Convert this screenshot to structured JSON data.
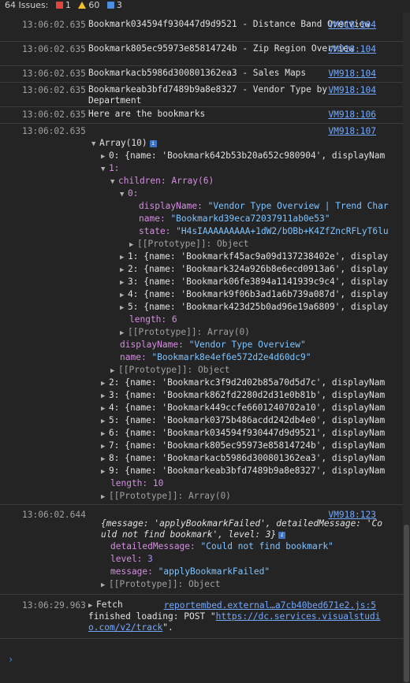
{
  "issues": {
    "label": "64 Issues:",
    "errors": "1",
    "warnings": "60",
    "infos": "3"
  },
  "messages": [
    {
      "ts": "13:06:02.635",
      "text": "Bookmark034594f930447d9d9521 - Distance Band Overview",
      "src": "VM918:104"
    },
    {
      "ts": "13:06:02.635",
      "text": "Bookmark805ec95973e85814724b - Zip Region Overview",
      "src": "VM918:104"
    },
    {
      "ts": "13:06:02.635",
      "text": "Bookmarkacb5986d300801362ea3 - Sales Maps",
      "src": "VM918:104"
    },
    {
      "ts": "13:06:02.635",
      "text": "Bookmarkeab3bfd7489b9a8e8327 - Vendor Type by Department",
      "src": "VM918:104"
    },
    {
      "ts": "13:06:02.635",
      "text": "Here are the bookmarks",
      "src": "VM918:106"
    }
  ],
  "array_msg": {
    "ts": "13:06:02.635",
    "src": "VM918:107",
    "head": "Array(10)",
    "item0": "0: {name: 'Bookmark642b53b20a652c980904', displayNam",
    "item1": "1:",
    "children": "children: Array(6)",
    "child0": "0:",
    "dn_key": "displayName:",
    "dn_val": "\"Vendor Type Overview | Trend Char",
    "name_key": "name:",
    "name_val": "\"Bookmarkd39eca72037911ab0e53\"",
    "state_key": "state:",
    "state_val": "\"H4sIAAAAAAAAA+1dW2/bOBb+K4ZfZncRFLyT6lu",
    "proto_obj": "[[Prototype]]: Object",
    "c1": "1: {name: 'Bookmarkf45ac9a09d137238402e', display",
    "c2": "2: {name: 'Bookmark324a926b8e6ecd0913a6', display",
    "c3": "3: {name: 'Bookmark06fe3894a1141939c9c4', display",
    "c4": "4: {name: 'Bookmark9f06b3ad1a6b739a087d', display",
    "c5": "5: {name: 'Bookmark423d25b0ad96e19a6809', display",
    "len6": "length: 6",
    "proto_arr0": "[[Prototype]]: Array(0)",
    "dn2_key": "displayName:",
    "dn2_val": "\"Vendor Type Overview\"",
    "name2_key": "name:",
    "name2_val": "\"Bookmark8e4ef6e572d2e4d60dc9\"",
    "proto_obj2": "[[Prototype]]: Object",
    "i2": "2: {name: 'Bookmarkc3f9d2d02b85a70d5d7c', displayNam",
    "i3": "3: {name: 'Bookmark862fd2280d2d31e0b81b', displayNam",
    "i4": "4: {name: 'Bookmark449ccfe6601240702a10', displayNam",
    "i5": "5: {name: 'Bookmark0375b486acdd242db4e0', displayNam",
    "i6": "6: {name: 'Bookmark034594f930447d9d9521', displayNam",
    "i7": "7: {name: 'Bookmark805ec95973e85814724b', displayNam",
    "i8": "8: {name: 'Bookmarkacb5986d300801362ea3', displayNam",
    "i9": "9: {name: 'Bookmarkeab3bfd7489b9a8e8327', displayNam",
    "len10": "length: 10",
    "proto_arr0b": "[[Prototype]]: Array(0)"
  },
  "error_msg": {
    "ts": "13:06:02.644",
    "src": "VM918:123",
    "line1": "{message: 'applyBookmarkFailed', detailedMessage: 'Co",
    "line2": "uld not find bookmark', level: 3}",
    "dm_key": "detailedMessage:",
    "dm_val": "\"Could not find bookmark\"",
    "lv_key": "level:",
    "lv_val": "3",
    "msg_key": "message:",
    "msg_val": "\"applyBookmarkFailed\"",
    "proto": "[[Prototype]]: Object"
  },
  "fetch_msg": {
    "ts": "13:06:29.963",
    "src": "reportembed.external…a7cb40bed671e2.js:5",
    "fetch": "Fetch",
    "text1": "finished loading: POST \"",
    "url1": "https://dc.services.visualstudi",
    "url2": "o.com/v2/track",
    "text2": "\"."
  },
  "prompt": "›"
}
